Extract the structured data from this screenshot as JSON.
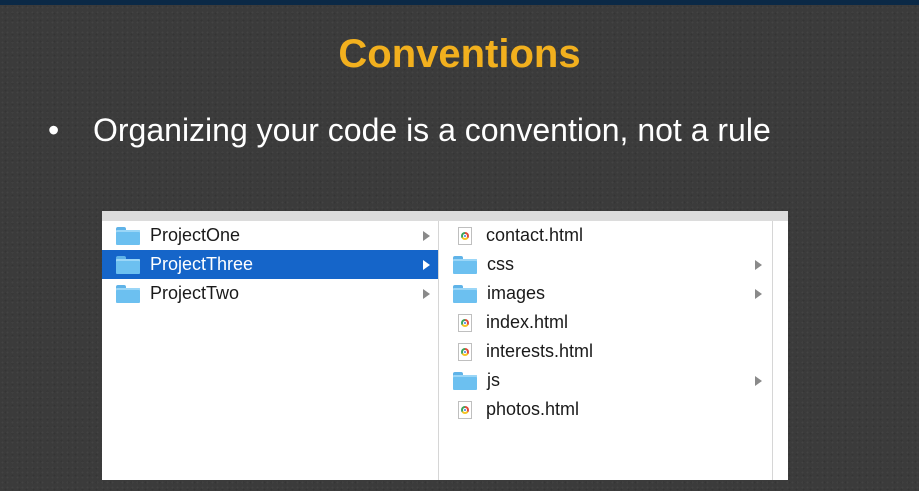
{
  "slide": {
    "title": "Conventions",
    "bullet_symbol": "•",
    "bullet_text": "Organizing your code is a convention, not a rule"
  },
  "finder": {
    "column1": [
      {
        "label": "ProjectOne",
        "icon": "folder-icon",
        "selected": false
      },
      {
        "label": "ProjectThree",
        "icon": "folder-icon",
        "selected": true
      },
      {
        "label": "ProjectTwo",
        "icon": "folder-icon",
        "selected": false
      }
    ],
    "column2": [
      {
        "label": "contact.html",
        "icon": "html-file-icon"
      },
      {
        "label": "css",
        "icon": "folder-icon"
      },
      {
        "label": "images",
        "icon": "folder-icon"
      },
      {
        "label": "index.html",
        "icon": "html-file-icon"
      },
      {
        "label": "interests.html",
        "icon": "html-file-icon"
      },
      {
        "label": "js",
        "icon": "folder-icon"
      },
      {
        "label": "photos.html",
        "icon": "html-file-icon"
      }
    ]
  },
  "colors": {
    "title": "#f2b01e",
    "selection": "#1565c9",
    "background": "#3b3b3b"
  }
}
